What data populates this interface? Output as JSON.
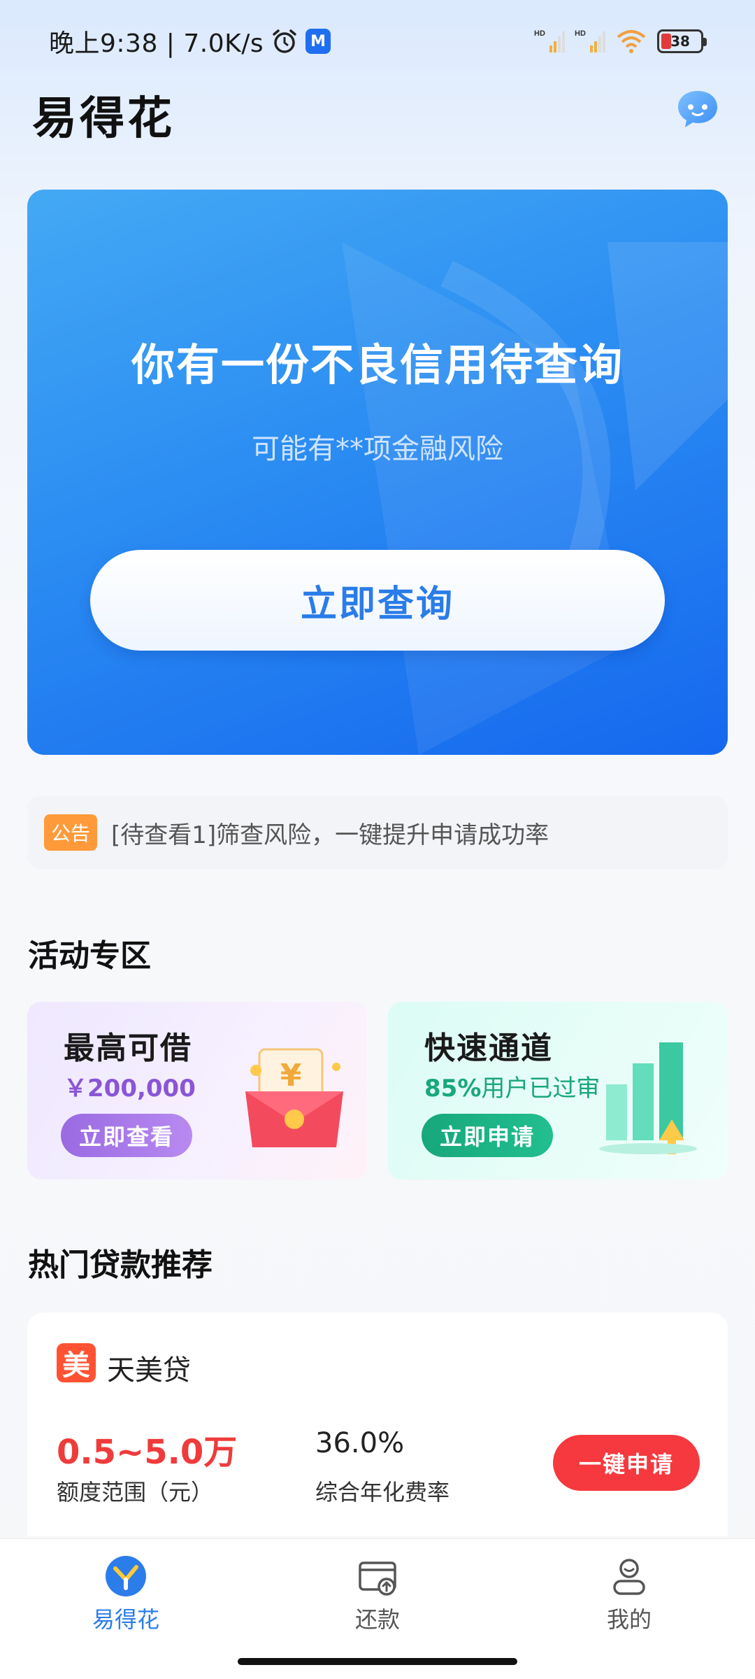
{
  "status_bar": {
    "time_speed": "晚上9:38 | 7.0K/s",
    "signal_label_1": "HD",
    "signal_label_2": "HD",
    "battery": "38"
  },
  "header": {
    "title": "易得花"
  },
  "hero": {
    "title": "你有一份不良信用待查询",
    "subtitle": "可能有**项金融风险",
    "button": "立即查询"
  },
  "notice": {
    "tag": "公告",
    "text": "[待查看1]筛查风险，一键提升申请成功率"
  },
  "activity": {
    "title": "活动专区",
    "cards": [
      {
        "title": "最高可借",
        "sub_strong": "￥200,000",
        "sub_muted": "",
        "button": "立即查看"
      },
      {
        "title": "快速通道",
        "sub_strong": "85%",
        "sub_muted": "用户已过审",
        "button": "立即申请"
      }
    ]
  },
  "loans": {
    "title": "热门贷款推荐",
    "items": [
      {
        "logo": "美",
        "name": "天美贷",
        "range": "0.5~5.0万",
        "range_label": "额度范围（元）",
        "rate": "36.0%",
        "rate_label": "综合年化费率",
        "button": "一键申请"
      }
    ]
  },
  "tabs": [
    {
      "label": "易得花",
      "icon": "home-logo-icon",
      "active": true
    },
    {
      "label": "还款",
      "icon": "repay-card-icon",
      "active": false
    },
    {
      "label": "我的",
      "icon": "user-profile-icon",
      "active": false
    }
  ],
  "colors": {
    "brand_blue": "#2b7de9",
    "hero_gradient_end": "#1568ee",
    "loan_red": "#f5393e",
    "notice_orange": "#ff9a3a",
    "activity_purple": "#9a6ae2",
    "activity_green": "#17a77b"
  }
}
